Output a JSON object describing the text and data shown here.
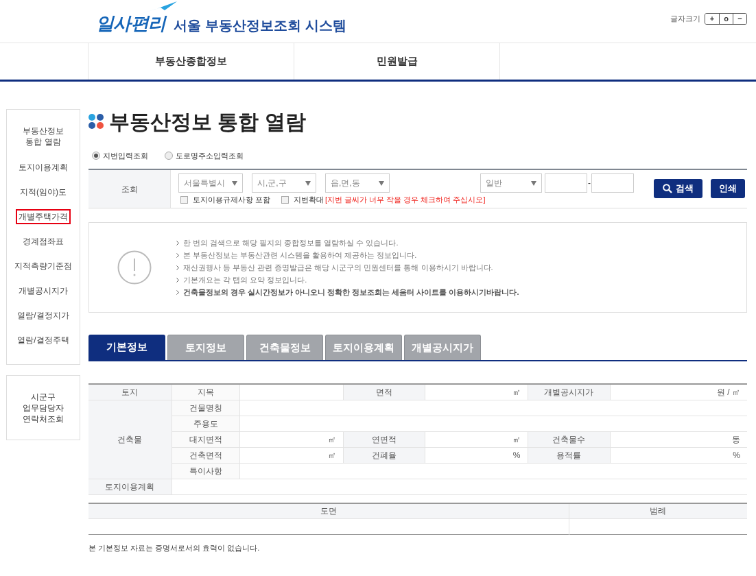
{
  "header": {
    "logo_text": "일사편리",
    "site_title": "서울 부동산정보조회 시스템",
    "font_size_label": "글자크기",
    "font_size_buttons": [
      "+",
      "o",
      "−"
    ]
  },
  "nav": [
    {
      "label": "부동산종합정보",
      "selected": false
    },
    {
      "label": "민원발급",
      "selected": false
    }
  ],
  "sidebar": {
    "items": [
      {
        "label": "부동산정보 통합 열람",
        "selected": false
      },
      {
        "label": "토지이용계획",
        "selected": false
      },
      {
        "label": "지적(임야)도",
        "selected": false
      },
      {
        "label": "개별주택가격",
        "selected": true
      },
      {
        "label": "경계점좌표",
        "selected": false
      },
      {
        "label": "지적측량기준점",
        "selected": false
      },
      {
        "label": "개별공시지가",
        "selected": false
      },
      {
        "label": "열람/결정지가",
        "selected": false
      },
      {
        "label": "열람/결정주택",
        "selected": false
      }
    ],
    "contact_link": "시군구 업무담당자 연락처조회"
  },
  "page_title": "부동산정보 통합 열람",
  "search_modes": [
    {
      "label": "지번입력조회",
      "selected": true
    },
    {
      "label": "도로명주소입력조회",
      "selected": false
    }
  ],
  "search": {
    "label": "조회",
    "selects": [
      "서울특별시",
      "시,군,구",
      "읍,면,동"
    ],
    "type_select": "일반",
    "separator": "-",
    "options": [
      {
        "label": "토지이용규제사항 포함",
        "checked": false
      },
      {
        "label": "지번확대",
        "checked": false,
        "note": "[지번 글씨가 너무 작을 경우 체크하여 주십시오]"
      }
    ],
    "buttons": [
      {
        "label": "검색",
        "kind": "search"
      },
      {
        "label": "인쇄",
        "kind": "plain"
      }
    ]
  },
  "notice": [
    {
      "text": "한 번의 검색으로 해당 필지의 종합정보를 열람하실 수 있습니다.",
      "emphasis": false
    },
    {
      "text": "본 부동산정보는 부동산관련 시스템을 활용하여 제공하는 정보입니다.",
      "emphasis": false
    },
    {
      "text": "재산권행사 등 부동산 관련 증명발급은 해당 시군구의 민원센터를 통해 이용하시기 바랍니다.",
      "emphasis": false
    },
    {
      "text": "기본개요는 각 탭의 요약 정보입니다.",
      "emphasis": false
    },
    {
      "text": "건축물정보의 경우 실시간정보가 아니오니 정확한 정보조회는 세움터 사이트를 이용하시기바랍니다.",
      "emphasis": true
    }
  ],
  "tabs": [
    {
      "label": "기본정보",
      "selected": true
    },
    {
      "label": "토지정보",
      "selected": false
    },
    {
      "label": "건축물정보",
      "selected": false
    },
    {
      "label": "토지이용계획",
      "selected": false
    },
    {
      "label": "개별공시지가",
      "selected": false
    }
  ],
  "basic_info": {
    "land": {
      "label": "토지",
      "fields": [
        {
          "label": "지목"
        },
        {
          "label": "면적",
          "unit": "㎡"
        },
        {
          "label": "개별공시지가",
          "unit": "원 / ㎡"
        }
      ]
    },
    "building": {
      "label": "건축물",
      "rows": [
        [
          {
            "label": "건물명칭"
          }
        ],
        [
          {
            "label": "주용도"
          }
        ],
        [
          {
            "label": "대지면적",
            "unit": "㎡"
          },
          {
            "label": "연면적",
            "unit": "㎡"
          },
          {
            "label": "건축물수",
            "unit": "동"
          }
        ],
        [
          {
            "label": "건축면적",
            "unit": "㎡"
          },
          {
            "label": "건폐율",
            "unit": "%"
          },
          {
            "label": "용적률",
            "unit": "%"
          }
        ],
        [
          {
            "label": "특이사항"
          }
        ]
      ]
    },
    "land_use_plan": {
      "label": "토지이용계획"
    }
  },
  "map_table": {
    "columns": [
      "도면",
      "범례"
    ]
  },
  "footnote": "본 기본정보 자료는 증명서로서의 효력이 없습니다."
}
